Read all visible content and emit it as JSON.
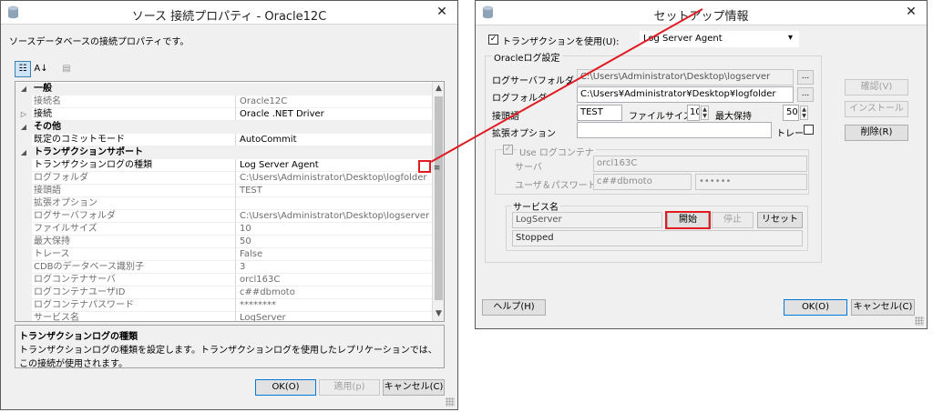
{
  "left_window": {
    "title": "ソース 接続プロパティ - Oracle12C",
    "close_glyph": "✕",
    "description": "ソースデータベースの接続プロパティです。",
    "toolbar": {
      "categorized_glyph": "☷",
      "alphabetical_glyph": "A↓",
      "pages_glyph": "▤"
    },
    "properties": [
      {
        "type": "cat",
        "expander": "◢",
        "name": "一般"
      },
      {
        "type": "prop",
        "expander": "",
        "name": "接続名",
        "value": "Oracle12C",
        "style": "gray"
      },
      {
        "type": "prop",
        "expander": "▷",
        "name": "接続",
        "value": "Oracle .NET Driver",
        "style": "act"
      },
      {
        "type": "cat",
        "expander": "◢",
        "name": "その他"
      },
      {
        "type": "prop",
        "expander": "",
        "name": "既定のコミットモード",
        "value": "AutoCommit",
        "style": "act"
      },
      {
        "type": "cat",
        "expander": "◢",
        "name": "トランザクションサポート"
      },
      {
        "type": "prop",
        "expander": "",
        "name": "トランザクションログの種類",
        "value": "Log Server Agent",
        "style": "act sel"
      },
      {
        "type": "prop",
        "expander": "",
        "name": "ログフォルダ",
        "value": "C:\\Users\\Administrator\\Desktop\\logfolder",
        "style": "gray"
      },
      {
        "type": "prop",
        "expander": "",
        "name": "接頭語",
        "value": "TEST",
        "style": "gray"
      },
      {
        "type": "prop",
        "expander": "",
        "name": "拡張オプション",
        "value": "",
        "style": "gray"
      },
      {
        "type": "prop",
        "expander": "",
        "name": "ログサーバフォルダ",
        "value": "C:\\Users\\Administrator\\Desktop\\logserver",
        "style": "gray"
      },
      {
        "type": "prop",
        "expander": "",
        "name": "ファイルサイズ",
        "value": "10",
        "style": "gray"
      },
      {
        "type": "prop",
        "expander": "",
        "name": "最大保持",
        "value": "50",
        "style": "gray"
      },
      {
        "type": "prop",
        "expander": "",
        "name": "トレース",
        "value": "False",
        "style": "gray"
      },
      {
        "type": "prop",
        "expander": "",
        "name": "CDBのデータベース識別子",
        "value": "3",
        "style": "gray"
      },
      {
        "type": "prop",
        "expander": "",
        "name": "ログコンテナサーバ",
        "value": "orcl163C",
        "style": "gray"
      },
      {
        "type": "prop",
        "expander": "",
        "name": "ログコンテナユーザID",
        "value": "c##dbmoto",
        "style": "gray"
      },
      {
        "type": "prop",
        "expander": "",
        "name": "ログコンテナパスワード",
        "value": "********",
        "style": "gray"
      },
      {
        "type": "prop",
        "expander": "",
        "name": "サービス名",
        "value": "LogServer",
        "style": "gray"
      }
    ],
    "scroll_up": "▲",
    "scroll_down": "▼",
    "ellipsis": "≡",
    "desc_title": "トランザクションログの種類",
    "desc_text": "トランザクションログの種類を設定します。トランザクションログを使用したレプリケーションでは、この接続が使用されます。",
    "ok_label": "OK(O)",
    "apply_label": "適用(p)",
    "cancel_label": "キャンセル(C)"
  },
  "right_window": {
    "title": "セットアップ情報",
    "close_glyph": "✕",
    "use_transaction_label": "トランザクションを使用(U):",
    "check_mark": "✓",
    "transaction_type": "Log Server Agent",
    "dropdown_glyph": "▾",
    "oracle_log_group": "Oracleログ設定",
    "log_server_folder_label": "ログサーバフォルダ",
    "log_server_folder_value": "C:\\Users\\Administrator\\Desktop\\logserver",
    "browse_label": "...",
    "log_folder_label": "ログフォルダ",
    "log_folder_value": "C:\\Users¥Administrator¥Desktop¥logfolder",
    "prefix_label": "接頭語",
    "prefix_value": "TEST",
    "file_size_label": "ファイルサイズ",
    "file_size_value": "10",
    "max_keep_label": "最大保持",
    "max_keep_value": "50",
    "ext_option_label": "拡張オプション",
    "ext_option_value": "",
    "trace_label": "トレー",
    "use_log_container_label": "Use ログコンテナ",
    "server_label": "サーバ",
    "server_value": "orcl163C",
    "user_pass_label": "ユーザ＆パスワード",
    "user_value": "c##dbmoto",
    "password_value": "••••••",
    "service_group": "サービス名",
    "service_value": "LogServer",
    "start_label": "開始",
    "stop_label": "停止",
    "reset_label": "リセット",
    "status_value": "Stopped",
    "confirm_label": "確認(V)",
    "install_label": "インストール",
    "delete_label": "削除(R)",
    "help_label": "ヘルプ(H)",
    "ok_label": "OK(O)",
    "cancel_label": "キャンセル(C)",
    "spin_up": "▲",
    "spin_down": "▼"
  },
  "colors": {
    "highlight": "#e11b22",
    "default_button_border": "#0078d7"
  }
}
